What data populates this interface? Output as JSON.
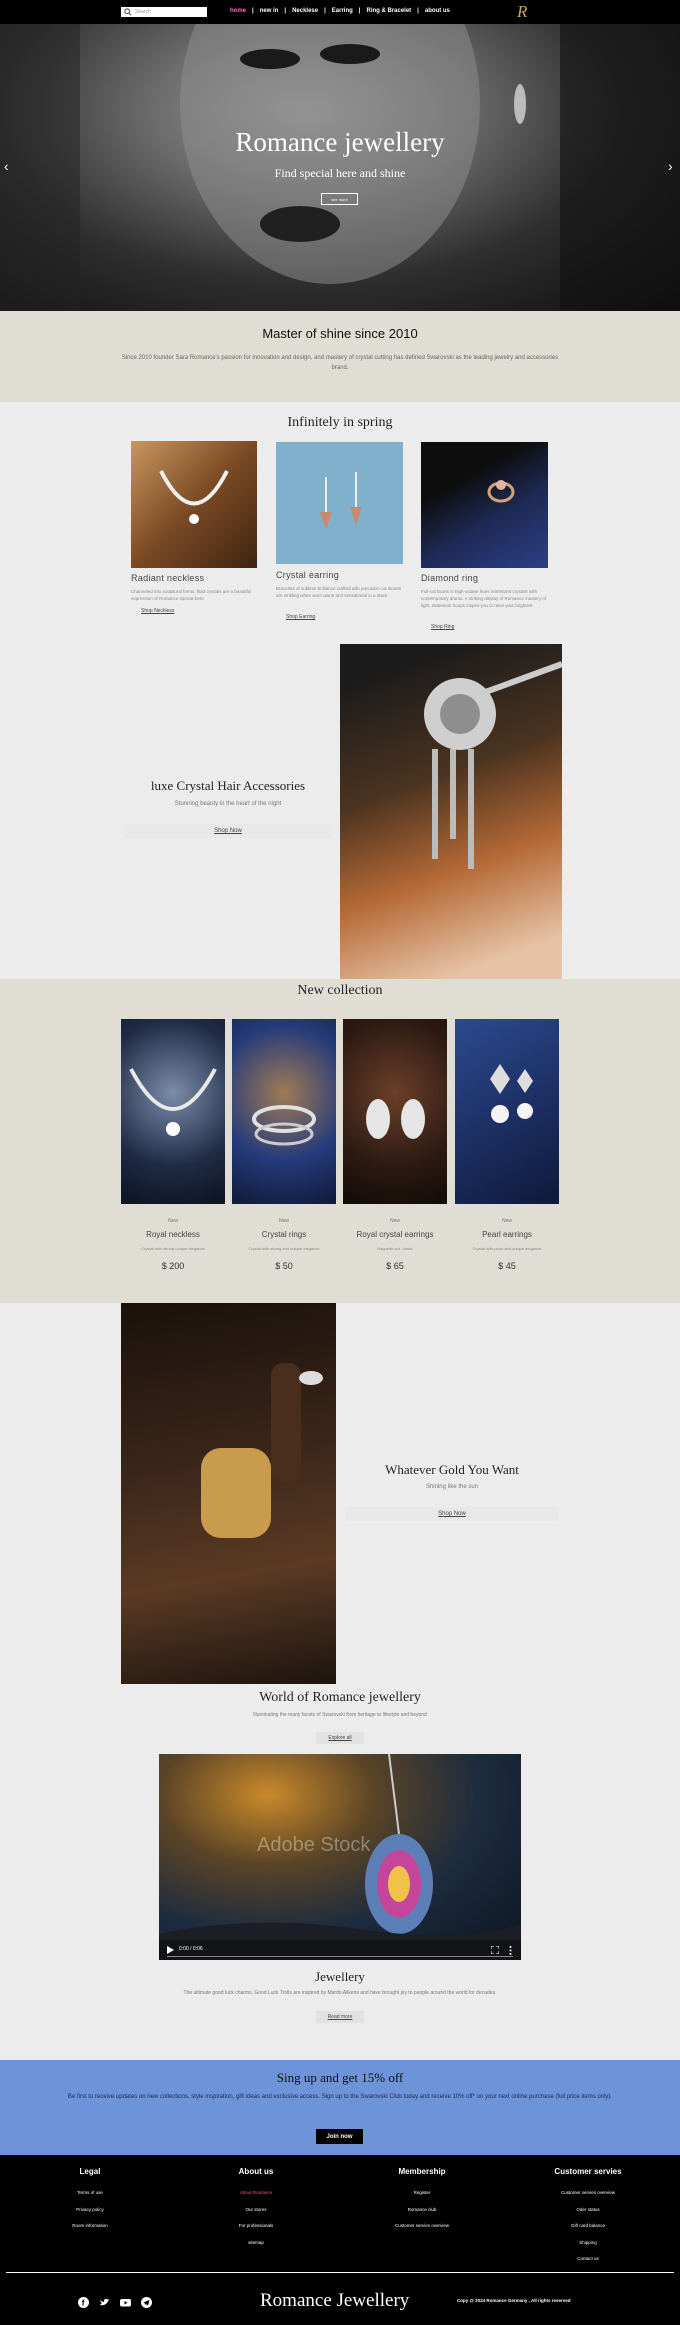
{
  "header": {
    "search_placeholder": "Search",
    "nav": [
      "home",
      "new in",
      "Necklese",
      "Earring",
      "Ring & Bracelet",
      "about us"
    ],
    "logo": "R"
  },
  "hero": {
    "title": "Romance jewellery",
    "subtitle": "Find special here and shine",
    "button": "see more"
  },
  "master": {
    "title": "Master of shine since 2010",
    "text": "Since 2010 founder Sara Romance's passion for innovation and design, and mastery of crystal cutting has defined Swarovski as the leading jewelry and accessories brand."
  },
  "spring": {
    "title": "Infinitely in spring",
    "cards": [
      {
        "name": "Radiant neckless",
        "desc": "Channeled into sculptural forms, fluid crystals are a beautiful expression of Romance special here",
        "link": "Shop Neckless"
      },
      {
        "name": "Crystal earring",
        "desc": "Bracelets of sublime brilliance crafted with precision-cut stones are strikling when worn alone and sensational in a stack",
        "link": "Shop Earring"
      },
      {
        "name": "Diamond ring",
        "desc": "Full-cut facets in high-octane hues reinterpret crystals with contemporary drama. A striking display of Romance mastery of light, statement hoops inspire you to raise your brightest",
        "link": "Shop Ring"
      }
    ]
  },
  "hair": {
    "title": "luxe Crystal Hair Accessories",
    "subtitle": "Stunning beauty in the heart of the night",
    "button": "Shop Now"
  },
  "new_collection": {
    "title": "New collection",
    "items": [
      {
        "label": "New",
        "name": "Royal neckless",
        "desc": "Crystal with strong unique elegance",
        "price": "$ 200"
      },
      {
        "label": "New",
        "name": "Crystal rings",
        "desc": "Crystal with strong and unique elegance",
        "price": "$ 50"
      },
      {
        "label": "New",
        "name": "Royal crystal earrings",
        "desc": "Baguette cut , black",
        "price": "$ 65"
      },
      {
        "label": "New",
        "name": "Pearl earrings",
        "desc": "Crystal with pearl and unique elegance",
        "price": "$ 45"
      }
    ]
  },
  "gold": {
    "title": "Whatever Gold You Want",
    "subtitle": "Shining like the sun",
    "button": "Shop Now"
  },
  "world": {
    "title": "World of Romance jewellery",
    "subtitle": "Illuminating the many facets of Swarovski from heritage to lifestyle and beyond",
    "button": "Explore all"
  },
  "video": {
    "watermark": "Adobe Stock",
    "time": "0:00 / 0:06"
  },
  "jewellery": {
    "title": "Jewellery",
    "text": "The ultimate good luck charms, Good Luck Trolls are inspired by Mardo Ailkens and have brought joy to people around the  world for decades.",
    "button": "Read more"
  },
  "signup": {
    "title": "Sing up and get 15% off",
    "text": "Be first to receive updates on new collections, style inspiration, gift ideas and exclusive access. Sign up to the Swarovski Club today and receive 10% off* on your next online purchase (full price items only).",
    "button": "Join now"
  },
  "footer": {
    "columns": [
      {
        "title": "Legal",
        "links": [
          "Terms of use",
          "Privacy policy",
          "Room information"
        ]
      },
      {
        "title": "About us",
        "links": [
          "About Romance",
          "Our stores",
          "For professionals",
          "sitemap"
        ]
      },
      {
        "title": "Membership",
        "links": [
          "Register",
          "Romance club",
          "Customer servies overview"
        ]
      },
      {
        "title": "Customer servies",
        "links": [
          "Customer servies overview",
          "Oder status",
          "Gift card balance",
          "Shipping",
          "Contact us"
        ]
      }
    ],
    "logo": "Romance Jewellery",
    "copyright": "Copy @ 2024 Romance Germany , All rights reserved",
    "social_icons": [
      "facebook-icon",
      "twitter-icon",
      "youtube-icon",
      "telegram-icon"
    ],
    "highlight_color": "#ff4f9a"
  },
  "colors": {
    "accent_nav": "#ff6ad5",
    "signup_bg": "#6d93d9",
    "beige_bg": "#e0ddd5",
    "logo_gold": "#c9a35f"
  }
}
